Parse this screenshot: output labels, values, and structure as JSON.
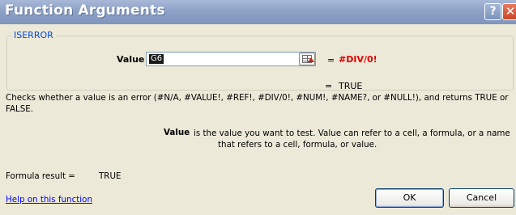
{
  "window": {
    "title": "Function Arguments",
    "help_icon": "question-mark-icon",
    "close_icon": "close-x-icon"
  },
  "function": {
    "name": "ISERROR",
    "argument": {
      "label": "Value",
      "input_value": "G6",
      "evaluated_result": "#DIV/0!"
    },
    "result_equals": "=",
    "result": "TRUE",
    "description": "Checks whether a value is an error (#N/A, #VALUE!, #REF!, #DIV/0!, #NUM!, #NAME?, or #NULL!), and returns TRUE or FALSE.",
    "parameter": {
      "name": "Value",
      "desc_line1": "is the value you want to test. Value can refer to a cell, a formula, or a name",
      "desc_line2": "that refers to a cell, formula, or value."
    }
  },
  "footer": {
    "formula_result_label": "Formula result =",
    "formula_result_value": "TRUE",
    "help_link": "Help on this function",
    "ok_label": "OK",
    "cancel_label": "Cancel"
  },
  "colors": {
    "accent_link": "#0000ff",
    "error_red": "#e00000",
    "title_bar": "#8da2c6",
    "dialog_bg": "#ece9d8"
  }
}
